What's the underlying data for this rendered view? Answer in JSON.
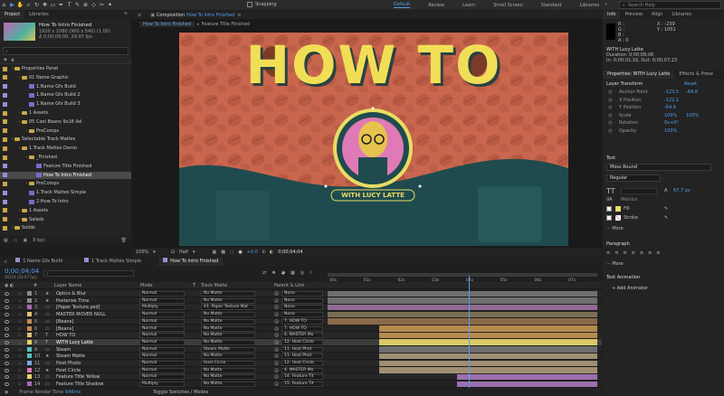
{
  "workspace": {
    "tabs": [
      "Default",
      "Review",
      "Learn",
      "Small Screen",
      "Standard",
      "Libraries"
    ],
    "active": "Default",
    "snapping": "Snapping",
    "search_placeholder": "Search Help"
  },
  "project": {
    "tabs": [
      "Project",
      "Libraries"
    ],
    "item_name": "How To Intro Finished",
    "item_line1": "1920 x 1080 (960 x 540) (1.00)",
    "item_line2": "Δ 0;00;06;00, 29.97 fps",
    "bpc": "8 bpc",
    "tree": [
      {
        "indent": 0,
        "type": "folder",
        "name": "Properties Panel"
      },
      {
        "indent": 1,
        "type": "folder",
        "name": "01 Name Graphic"
      },
      {
        "indent": 2,
        "type": "comp",
        "name": "1.Name Gfx Build"
      },
      {
        "indent": 2,
        "type": "comp",
        "name": "1.Name Gfx Build 2"
      },
      {
        "indent": 2,
        "type": "comp",
        "name": "1.Name Gfx Build 3"
      },
      {
        "indent": 1,
        "type": "folder",
        "name": "1 Assets"
      },
      {
        "indent": 1,
        "type": "folder",
        "name": "05 Cool Beans 9x16 Ad"
      },
      {
        "indent": 2,
        "type": "folder",
        "name": "PreComps"
      },
      {
        "indent": 0,
        "type": "folder",
        "name": "Selectable Track Mattes"
      },
      {
        "indent": 1,
        "type": "folder",
        "name": "1.Track Mattes Demo"
      },
      {
        "indent": 2,
        "type": "folder",
        "name": "_Finished"
      },
      {
        "indent": 3,
        "type": "comp",
        "name": "Feature Title Finished"
      },
      {
        "indent": 3,
        "type": "comp",
        "name": "How To Intro Finished",
        "selected": true
      },
      {
        "indent": 2,
        "type": "folder",
        "name": "PreComps"
      },
      {
        "indent": 2,
        "type": "comp",
        "name": "1.Track Mattes Simple"
      },
      {
        "indent": 2,
        "type": "comp",
        "name": "2.How To Intro"
      },
      {
        "indent": 1,
        "type": "folder",
        "name": "1 Assets"
      },
      {
        "indent": 1,
        "type": "folder",
        "name": "Salads"
      },
      {
        "indent": 0,
        "type": "folder",
        "name": "Solids"
      }
    ]
  },
  "composition": {
    "title": "Composition",
    "comp_name": "How To Intro Finished",
    "subtabs": [
      "How To Intro Finished",
      "Feature Title Finished"
    ],
    "headline": "HOW TO",
    "badge_text": "WITH LUCY LATTE",
    "footer": {
      "zoom": "100%",
      "resolution": "Half",
      "exposure": "+0.0",
      "timecode": "0;00;04;04"
    }
  },
  "info": {
    "tabs": [
      "Info",
      "Preview",
      "Align",
      "Libraries"
    ],
    "rgba": [
      "R :",
      "G :",
      "B :",
      "A : 0"
    ],
    "coords": [
      "X : -239",
      "Y : 1001"
    ],
    "layer_name": "WITH Lucy Latte",
    "duration": "Duration: 0;00;06;06",
    "inout": "In: 0;00;01;16, Out: 0;00;07;23"
  },
  "properties": {
    "tabs": [
      "Properties: WITH Lucy Latte",
      "Effects & Prese"
    ],
    "transform_label": "Layer Transform",
    "reset": "Reset",
    "rows": [
      {
        "label": "Anchor Point",
        "v1": "-123.5",
        "v2": "-84.8"
      },
      {
        "label": "X Position",
        "v1": "-122.1",
        "v2": ""
      },
      {
        "label": "Y Position",
        "v1": "-64.6",
        "v2": ""
      },
      {
        "label": "Scale",
        "v1": "100%",
        "v2": "100%"
      },
      {
        "label": "Rotation",
        "v1": "0x+0°",
        "v2": ""
      },
      {
        "label": "Opacity",
        "v1": "100%",
        "v2": ""
      }
    ],
    "text_section": "Text",
    "font": "Moss Round",
    "style": "Regular",
    "size": "67.7 px",
    "tracking": "Metrics",
    "fill": "Fill",
    "stroke": "Stroke",
    "more": "More",
    "paragraph_section": "Paragraph",
    "para_more": "More",
    "animation_section": "Text Animation",
    "add_animator": "Add Animator"
  },
  "timeline": {
    "tabs": [
      "1 Name Gfx Build",
      "1 Track Mattes Simple",
      "How To Intro Finished"
    ],
    "active_tab": "How To Intro Finished",
    "timecode": "0;00;04;04",
    "timecode_sub": "00124 (29.97 fps)",
    "search_placeholder": "",
    "headers": {
      "num": "#",
      "name": "Layer Name",
      "mode": "Mode",
      "t": "T",
      "matte": "Track Matte",
      "parent": "Parent & Link"
    },
    "ruler": [
      "00s",
      "01s",
      "02s",
      "03s",
      "04s",
      "05s",
      "06s",
      "07s"
    ],
    "playhead_time_s": 4.14,
    "duration_s": 7.9,
    "footer_left": "Frame Render Time",
    "footer_value": "646ms",
    "footer_center": "Toggle Switches / Modes",
    "layers": [
      {
        "n": "1",
        "name": "Optics & Blur",
        "mode": "Normal",
        "matte": "No Matte",
        "parent": "None",
        "color": "#8a8a8a",
        "bar_color": "#6f6f6f",
        "start": 0,
        "end": 7.9,
        "icon": "★"
      },
      {
        "n": "2",
        "name": "Posterize Time",
        "mode": "Normal",
        "matte": "No Matte",
        "parent": "None",
        "color": "#8a8a8a",
        "bar_color": "#6f6f6f",
        "start": 0,
        "end": 7.9,
        "icon": "★"
      },
      {
        "n": "3",
        "name": "[Paper Texture.psd]",
        "mode": "Multiply",
        "matte": "41. Paper Texture Mat",
        "parent": "None",
        "color": "#a56cb3",
        "bar_color": "#8f6a93",
        "start": 0,
        "end": 7.9,
        "icon": "▭"
      },
      {
        "n": "4",
        "name": "MASTER MOVER NULL",
        "mode": "Normal",
        "matte": "No Matte",
        "parent": "None",
        "color": "#e0c27a",
        "bar_color": "#7a6e55",
        "start": 0,
        "end": 7.9,
        "icon": "▭"
      },
      {
        "n": "5",
        "name": "[Beans]",
        "mode": "Normal",
        "matte": "No Matte",
        "parent": "7. HOW TO",
        "color": "#c58a4f",
        "bar_color": "#8a6a48",
        "start": 0,
        "end": 7.9,
        "icon": "▭"
      },
      {
        "n": "6",
        "name": "[Beans]",
        "mode": "Normal",
        "matte": "No Matte",
        "parent": "7. HOW TO",
        "color": "#c58a4f",
        "bar_color": "#b58a4f",
        "start": 1.5,
        "end": 7.9,
        "icon": "▭"
      },
      {
        "n": "7",
        "name": "HOW TO",
        "mode": "Normal",
        "matte": "No Matte",
        "parent": "4. MASTER Mo",
        "color": "#e0c27a",
        "bar_color": "#b58a4f",
        "start": 1.5,
        "end": 7.9,
        "icon": "T"
      },
      {
        "n": "8",
        "name": "WITH Lucy Latte",
        "mode": "Normal",
        "matte": "No Matte",
        "parent": "12. Host Circle",
        "color": "#e6d36a",
        "bar_color": "#d9c966",
        "start": 1.5,
        "end": 7.9,
        "icon": "T",
        "selected": true
      },
      {
        "n": "9",
        "name": "Steam",
        "mode": "Normal",
        "matte": "Steam Matte",
        "parent": "11. Host Phot",
        "color": "#5bbfc2",
        "bar_color": "#6e6e6e",
        "start": 1.5,
        "end": 7.9,
        "icon": "▭"
      },
      {
        "n": "10",
        "name": "Steam Matte",
        "mode": "Normal",
        "matte": "No Matte",
        "parent": "11. Host Phot",
        "color": "#5bbfc2",
        "bar_color": "#a08e74",
        "start": 1.5,
        "end": 7.9,
        "icon": "★"
      },
      {
        "n": "11",
        "name": "Host Photo",
        "mode": "Normal",
        "matte": "Host Circle",
        "parent": "12. Host Circle",
        "color": "#7aa5e0",
        "bar_color": "#a08e74",
        "start": 1.5,
        "end": 7.9,
        "icon": "▭"
      },
      {
        "n": "12",
        "name": "Host Circle",
        "mode": "Normal",
        "matte": "No Matte",
        "parent": "4. MASTER Mo",
        "color": "#e07ab6",
        "bar_color": "#a08e74",
        "start": 1.5,
        "end": 7.9,
        "icon": "★"
      },
      {
        "n": "13",
        "name": "Feature Title Yellow",
        "mode": "Normal",
        "matte": "No Matte",
        "parent": "14. Feature Tit",
        "color": "#e6d36a",
        "bar_color": "#9c6fb0",
        "start": 3.8,
        "end": 7.9,
        "icon": "▭"
      },
      {
        "n": "14",
        "name": "Feature Title Shadow",
        "mode": "Multiply",
        "matte": "No Matte",
        "parent": "15. Feature Tit",
        "color": "#a56cb3",
        "bar_color": "#9c6fb0",
        "start": 3.8,
        "end": 7.9,
        "icon": "▭"
      }
    ]
  }
}
